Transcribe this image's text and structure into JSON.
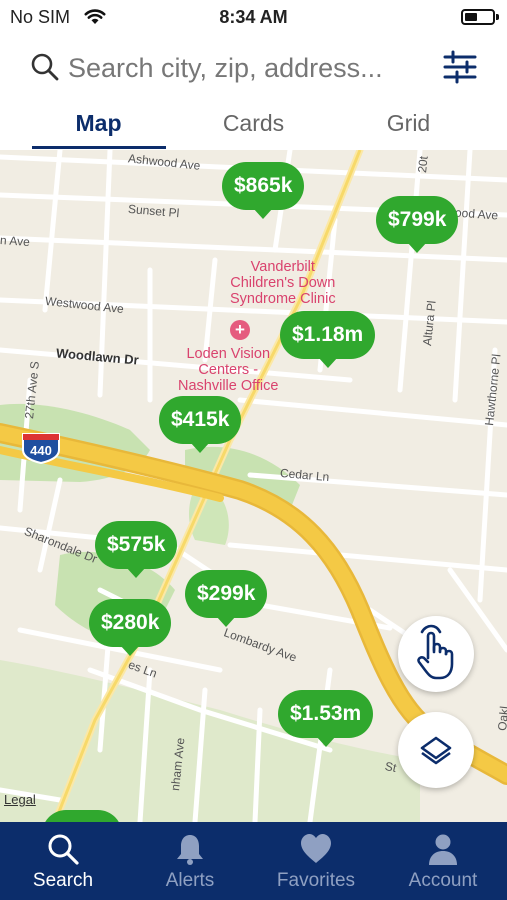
{
  "status_bar": {
    "carrier": "No SIM",
    "time": "8:34 AM"
  },
  "search": {
    "placeholder": "Search city, zip, address..."
  },
  "view_tabs": [
    {
      "label": "Map",
      "active": true
    },
    {
      "label": "Cards",
      "active": false
    },
    {
      "label": "Grid",
      "active": false
    }
  ],
  "map": {
    "streets": {
      "ashwood": "Ashwood Ave",
      "sunset": "Sunset Pl",
      "ave_left": "n Ave",
      "oodave": "ood Ave",
      "westwood": "Westwood Ave",
      "woodlawn": "Woodlawn Dr",
      "ave27": "27th Ave S",
      "altura": "Altura Pl",
      "hawthorne": "Hawthorne Pl",
      "cedar": "Cedar Ln",
      "sharondale": "Sharondale Dr",
      "lombardy": "Lombardy Ave",
      "esln": "es Ln",
      "nham": "nham Ave",
      "st": "St",
      "oakl": "Oakl",
      "twentieth": "20t",
      "interstate": "440"
    },
    "pois": {
      "vanderbilt": "Vanderbilt\nChildren's Down\nSyndrome Clinic",
      "loden": "Loden Vision\nCenters -\nNashville Office"
    },
    "pins": [
      "$865k",
      "$799k",
      "$1.18m",
      "$415k",
      "$575k",
      "$299k",
      "$280k",
      "$1.53m"
    ],
    "legal": "Legal",
    "colors": {
      "pin": "#30a82e",
      "map_bg": "#f1ede3",
      "highway": "#f4c945",
      "park": "#c8e2b1"
    }
  },
  "bottom_nav": [
    {
      "label": "Search",
      "icon": "search-icon",
      "active": true
    },
    {
      "label": "Alerts",
      "icon": "bell-icon",
      "active": false
    },
    {
      "label": "Favorites",
      "icon": "heart-icon",
      "active": false
    },
    {
      "label": "Account",
      "icon": "person-icon",
      "active": false
    }
  ],
  "theme": {
    "primary": "#0c2d6b",
    "inactive_nav": "#8fa0c2"
  }
}
